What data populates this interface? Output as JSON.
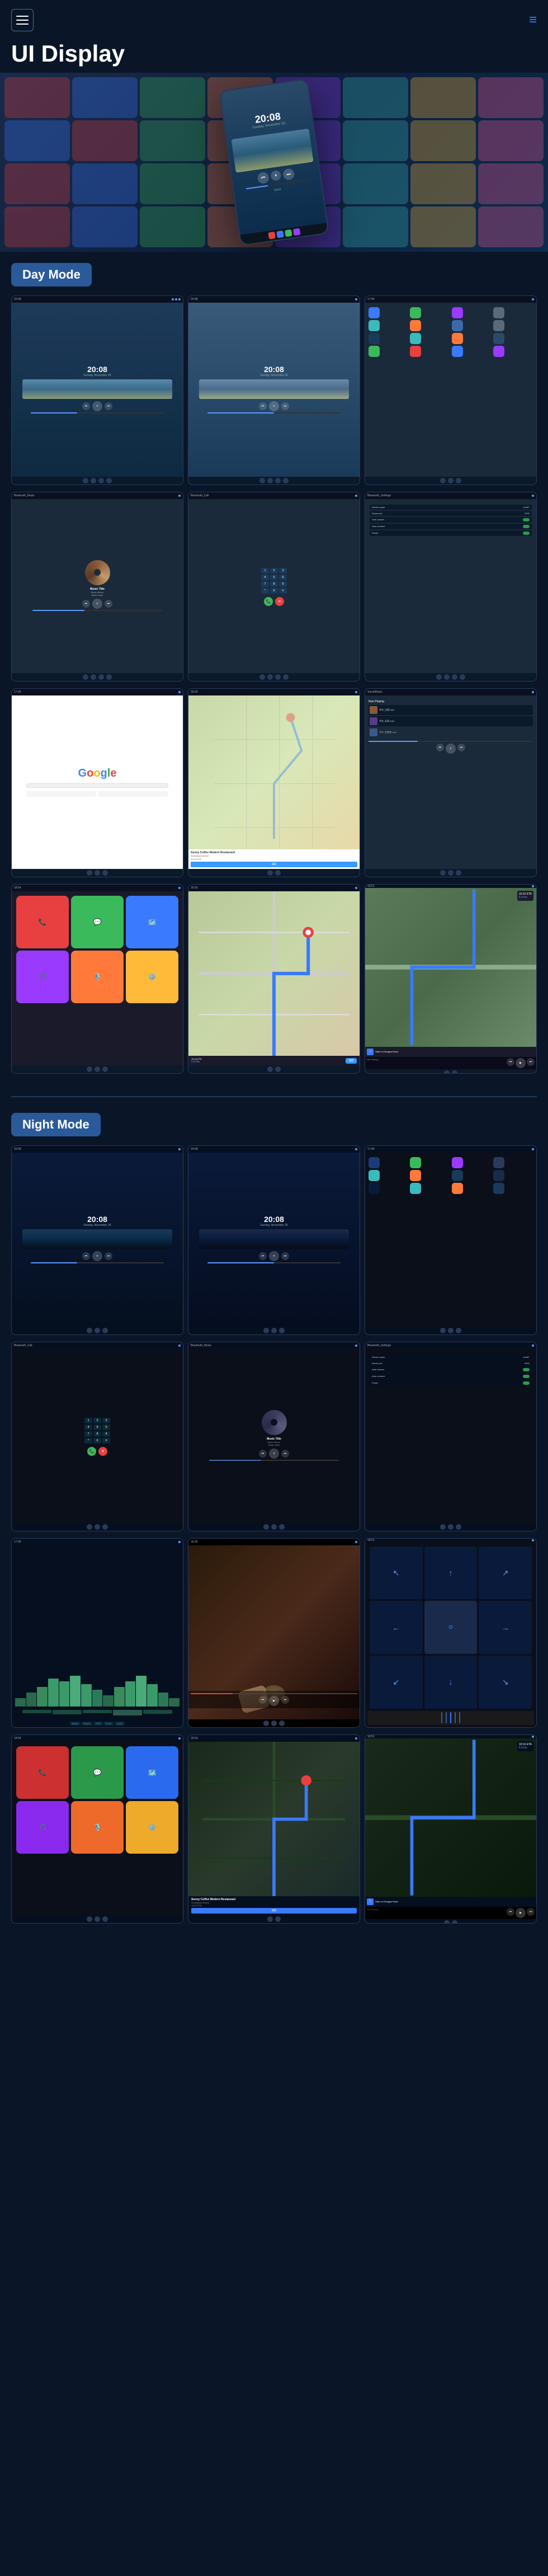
{
  "header": {
    "title": "UI Display",
    "menu_icon": "☰",
    "nav_icon": "≡"
  },
  "modes": {
    "day": "Day Mode",
    "night": "Night Mode"
  },
  "time": "20:08",
  "music": {
    "title": "Music Title",
    "album": "Music Album",
    "artist": "Music Artist"
  },
  "device": {
    "name_label": "Device name",
    "name_value": "CarBT",
    "pin_label": "Device pin",
    "pin_value": "0000",
    "answer_label": "Auto answer",
    "connect_label": "Auto connect",
    "power_label": "Power"
  },
  "navigation": {
    "restaurant": "Sunny Coffee Modern Restaurant",
    "address": "Guadalupe Beach",
    "eta": "19:16 ETA",
    "distance": "5.0 km",
    "go": "GO",
    "start": "Start on Dongjue Road"
  },
  "not_playing": "Not Playing",
  "google": "Google",
  "call": {
    "name": "Bluetooth_Call"
  },
  "bt_music": "Bluetooth_Music",
  "bt_settings": "Bluetooth_Settings",
  "social": "SocialMusic",
  "colors": {
    "accent_blue": "#3a7aff",
    "accent_green": "#3a9a4a",
    "bg_dark": "#0a1628",
    "day_mode_bg": "#1e3a5a",
    "night_mode_bg": "#0a1020"
  }
}
